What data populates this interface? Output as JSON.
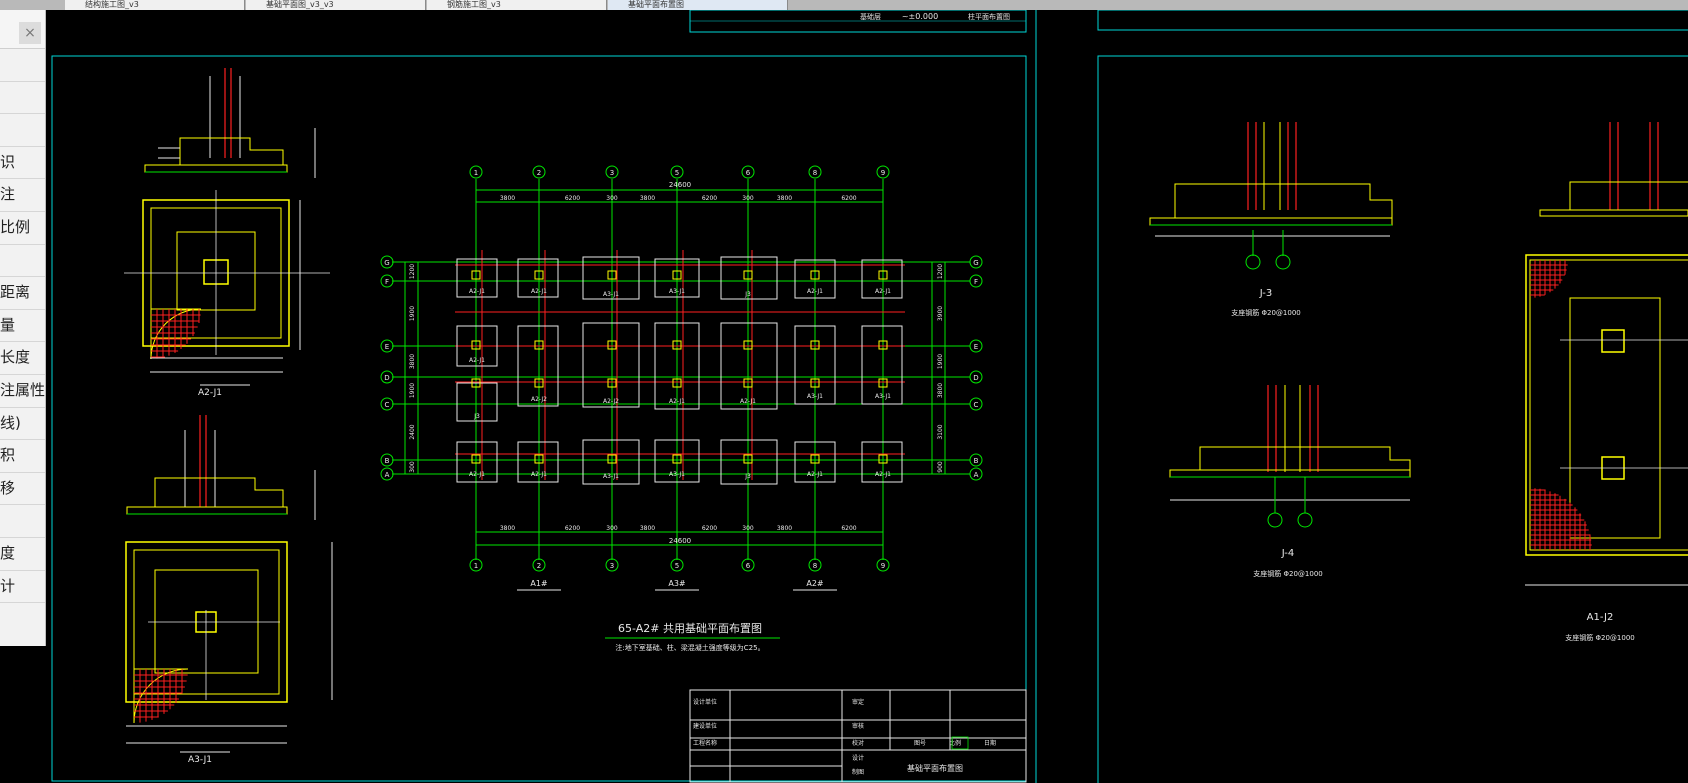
{
  "tabs": [
    {
      "label": "结构施工图_v3"
    },
    {
      "label": "基础平面图_v3_v3"
    },
    {
      "label": "钢筋施工图_v3"
    },
    {
      "label": "基础平面布置图"
    }
  ],
  "palette": {
    "close_glyph": "×",
    "items": [
      "",
      "",
      "",
      "识",
      "注",
      "比例",
      "",
      "距离",
      "量",
      "长度",
      "注属性",
      "线)",
      "积",
      "移",
      "",
      "度",
      "计"
    ]
  },
  "drawing": {
    "colors": {
      "frame": "#00d6d6",
      "grid": "#00e600",
      "axis": "#ff2020",
      "footing": "#ffff00",
      "text": "#e8e8e8",
      "hatch": "#ff2020"
    },
    "header_strip": {
      "prefix": "基础层",
      "elevation": "~±0.000",
      "title": "柱平面布置图"
    },
    "details_left": {
      "top_label": "A2-J1",
      "bottom_label": "A3-J1"
    },
    "plan": {
      "col_labels": [
        "1",
        "2",
        "3",
        "5",
        "6",
        "8",
        "9"
      ],
      "col_labels_b": [
        "4",
        "7"
      ],
      "row_labels": [
        "G",
        "F",
        "E",
        "D",
        "C",
        "B",
        "A"
      ],
      "top_dims": [
        "3800",
        "6200",
        "300",
        "3800",
        "6200",
        "300",
        "3800",
        "6200"
      ],
      "total": "24600",
      "bottom_dims": [
        "3800",
        "6200",
        "300",
        "3800",
        "6200",
        "300",
        "3800",
        "6200"
      ],
      "left_dims": [
        "1200",
        "1900",
        "3800",
        "1900",
        "2400",
        "300"
      ],
      "right_dims": [
        "1200",
        "3900",
        "1900",
        "3800",
        "3100",
        "900"
      ],
      "footings": [
        "A2-J1",
        "A2-J1",
        "A3-J1",
        "A3-J1",
        "J3",
        "A2-J1",
        "A2-J1",
        "A2-J1",
        "A2-J2",
        "A2-J2",
        "A2-J1",
        "A2-J1",
        "A3-J1",
        "A3-J1",
        "J3"
      ],
      "part_labels": [
        "A1#",
        "A3#",
        "A2#"
      ],
      "title": "65-A2#   共用基础平面布置图",
      "note": "注:地下室基础、柱、梁混凝土强度等级为C25。"
    },
    "title_block": {
      "rows": [
        "设计单位",
        "建设单位",
        "工程名称"
      ],
      "project": "基础平面布置图",
      "labels": [
        "审定",
        "审核",
        "校对",
        "设计",
        "制图"
      ],
      "scale_cells": [
        "图号",
        "比例",
        "日期"
      ]
    },
    "details_right": {
      "j3": "J-3",
      "j4": "J-4",
      "rebar_note": "支座钢筋 Φ20@1000",
      "a1j2": "A1-J2"
    }
  }
}
